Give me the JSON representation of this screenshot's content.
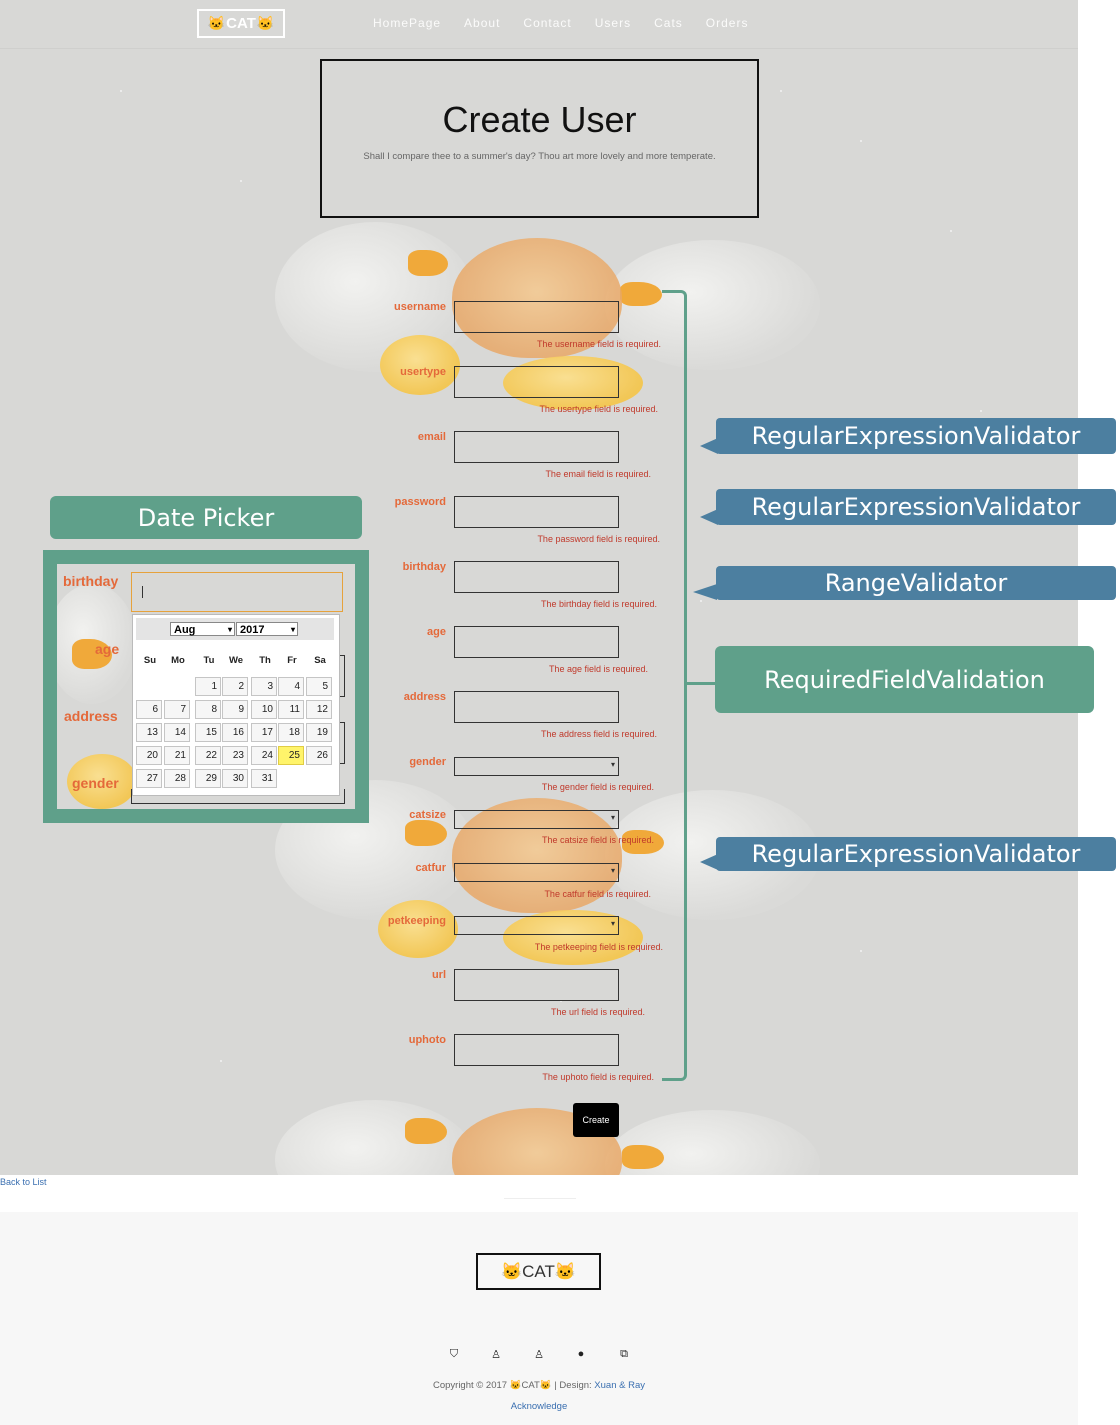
{
  "brand": {
    "text": "CAT",
    "icon": "cat-face-icon"
  },
  "nav": [
    "HomePage",
    "About",
    "Contact",
    "Users",
    "Cats",
    "Orders"
  ],
  "hero": {
    "title": "Create User",
    "subtitle": "Shall I compare thee to a summer's day? Thou art more lovely and more temperate."
  },
  "form": {
    "fields": [
      {
        "label": "username",
        "error": "The username field is required."
      },
      {
        "label": "usertype",
        "error": "The usertype field is required."
      },
      {
        "label": "email",
        "error": "The email field is required."
      },
      {
        "label": "password",
        "error": "The password field is required."
      },
      {
        "label": "birthday",
        "error": "The birthday field is required."
      },
      {
        "label": "age",
        "error": "The age field is required."
      },
      {
        "label": "address",
        "error": "The address field is required."
      },
      {
        "label": "gender",
        "error": "The gender field is required."
      },
      {
        "label": "catsize",
        "error": "The catsize field is required."
      },
      {
        "label": "catfur",
        "error": "The catfur field is required."
      },
      {
        "label": "petkeeping",
        "error": "The petkeeping field is required."
      },
      {
        "label": "url",
        "error": "The url field is required."
      },
      {
        "label": "uphoto",
        "error": "The uphoto field is required."
      }
    ],
    "submit": "Create"
  },
  "back_link": "Back to List",
  "annotations": {
    "date_picker": "Date Picker",
    "regex1": "RegularExpressionValidator",
    "regex2": "RegularExpressionValidator",
    "range": "RangeValidator",
    "required": "RequiredFieldValidation",
    "regex3": "RegularExpressionValidator"
  },
  "date_picker": {
    "labels": [
      "birthday",
      "age",
      "address",
      "gender"
    ],
    "month": "Aug",
    "year": "2017",
    "weekdays": [
      "Su",
      "Mo",
      "Tu",
      "We",
      "Th",
      "Fr",
      "Sa"
    ],
    "days": [
      "1",
      "2",
      "3",
      "4",
      "5",
      "6",
      "7",
      "8",
      "9",
      "10",
      "11",
      "12",
      "13",
      "14",
      "15",
      "16",
      "17",
      "18",
      "19",
      "20",
      "21",
      "22",
      "23",
      "24",
      "25",
      "26",
      "27",
      "28",
      "29",
      "30",
      "31"
    ],
    "first_weekday": 2,
    "highlighted_day": "25"
  },
  "footer": {
    "brand": "CAT",
    "social_icons": [
      "shield-icon",
      "person-icon",
      "person-icon",
      "github-icon",
      "copy-icon"
    ],
    "copyright_prefix": "Copyright © 2017",
    "copyright_brand": "CAT",
    "design_label": "| Design:",
    "designers": "Xuan & Ray",
    "acknowledge": "Acknowledge"
  },
  "colors": {
    "accent_label": "#e4693a",
    "callout_blue": "#4c7fa0",
    "callout_green": "#5fa08a",
    "error": "#c0392b"
  }
}
